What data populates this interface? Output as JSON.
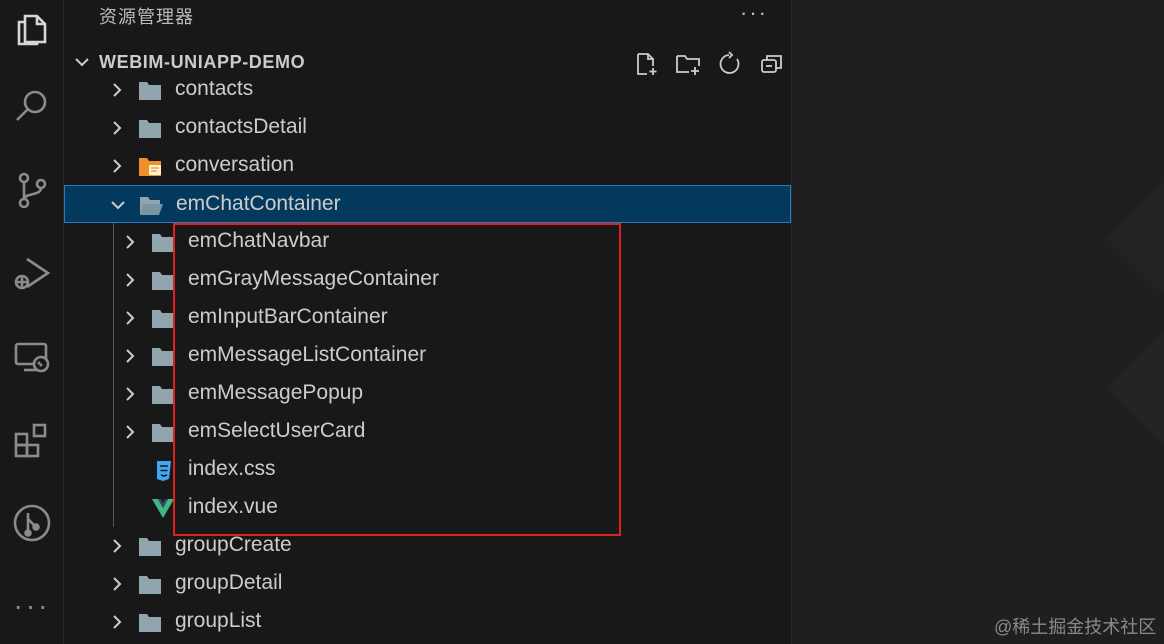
{
  "explorer": {
    "title": "资源管理器",
    "more_label": "···",
    "project_name": "WEBIM-UNIAPP-DEMO"
  },
  "tree": [
    {
      "label": "contacts",
      "depth": 0,
      "kind": "folder",
      "state": "collapsed"
    },
    {
      "label": "contactsDetail",
      "depth": 0,
      "kind": "folder",
      "state": "collapsed"
    },
    {
      "label": "conversation",
      "depth": 0,
      "kind": "folder-special",
      "state": "collapsed"
    },
    {
      "label": "emChatContainer",
      "depth": 0,
      "kind": "folder-open",
      "state": "expanded",
      "selected": true
    },
    {
      "label": "emChatNavbar",
      "depth": 1,
      "kind": "folder",
      "state": "collapsed"
    },
    {
      "label": "emGrayMessageContainer",
      "depth": 1,
      "kind": "folder",
      "state": "collapsed"
    },
    {
      "label": "emInputBarContainer",
      "depth": 1,
      "kind": "folder",
      "state": "collapsed"
    },
    {
      "label": "emMessageListContainer",
      "depth": 1,
      "kind": "folder",
      "state": "collapsed"
    },
    {
      "label": "emMessagePopup",
      "depth": 1,
      "kind": "folder",
      "state": "collapsed"
    },
    {
      "label": "emSelectUserCard",
      "depth": 1,
      "kind": "folder",
      "state": "collapsed"
    },
    {
      "label": "index.css",
      "depth": 1,
      "kind": "css-file"
    },
    {
      "label": "index.vue",
      "depth": 1,
      "kind": "vue-file"
    },
    {
      "label": "groupCreate",
      "depth": 0,
      "kind": "folder",
      "state": "collapsed"
    },
    {
      "label": "groupDetail",
      "depth": 0,
      "kind": "folder",
      "state": "collapsed"
    },
    {
      "label": "groupList",
      "depth": 0,
      "kind": "folder",
      "state": "collapsed"
    }
  ],
  "activity_icons": [
    "files-icon",
    "search-icon",
    "source-control-icon",
    "run-debug-icon",
    "remote-explorer-icon",
    "extensions-icon",
    "git-graph-icon"
  ],
  "section_actions": [
    "new-file-icon",
    "new-folder-icon",
    "refresh-icon",
    "collapse-all-icon"
  ],
  "watermark": "@稀土掘金技术社区",
  "colors": {
    "selection_bg": "#04395e",
    "selection_border": "#2d7bbf",
    "annotation_box": "#e0201f",
    "folder_icon": "#90a4ae",
    "special_folder_icon": "#f0902a",
    "css_icon": "#42a5f5",
    "vue_icon": "#41b883"
  }
}
